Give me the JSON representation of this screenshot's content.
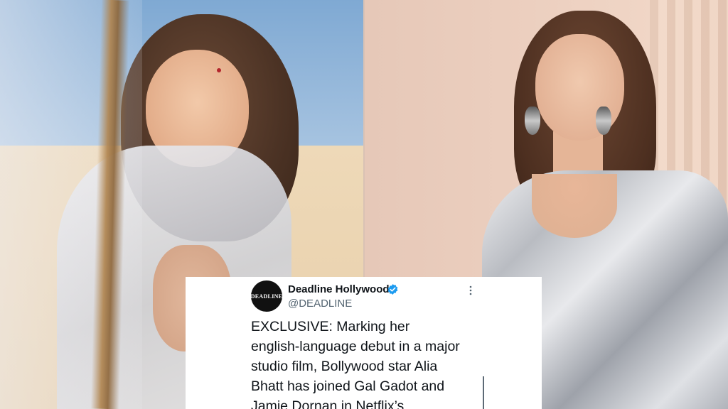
{
  "tweet": {
    "avatar_label": "DEADLINE",
    "display_name": "Deadline Hollywood",
    "handle": "@DEADLINE",
    "text": "EXCLUSIVE: Marking her\nenglish-language debut in a major\nstudio film, Bollywood star Alia\nBhatt has joined Gal Gadot and\nJamie Dornan in Netflix’s",
    "verified": true,
    "verified_color": "#1d9bf0"
  },
  "icons": {
    "verified": "verified-badge-icon",
    "more": "more-options-icon"
  }
}
